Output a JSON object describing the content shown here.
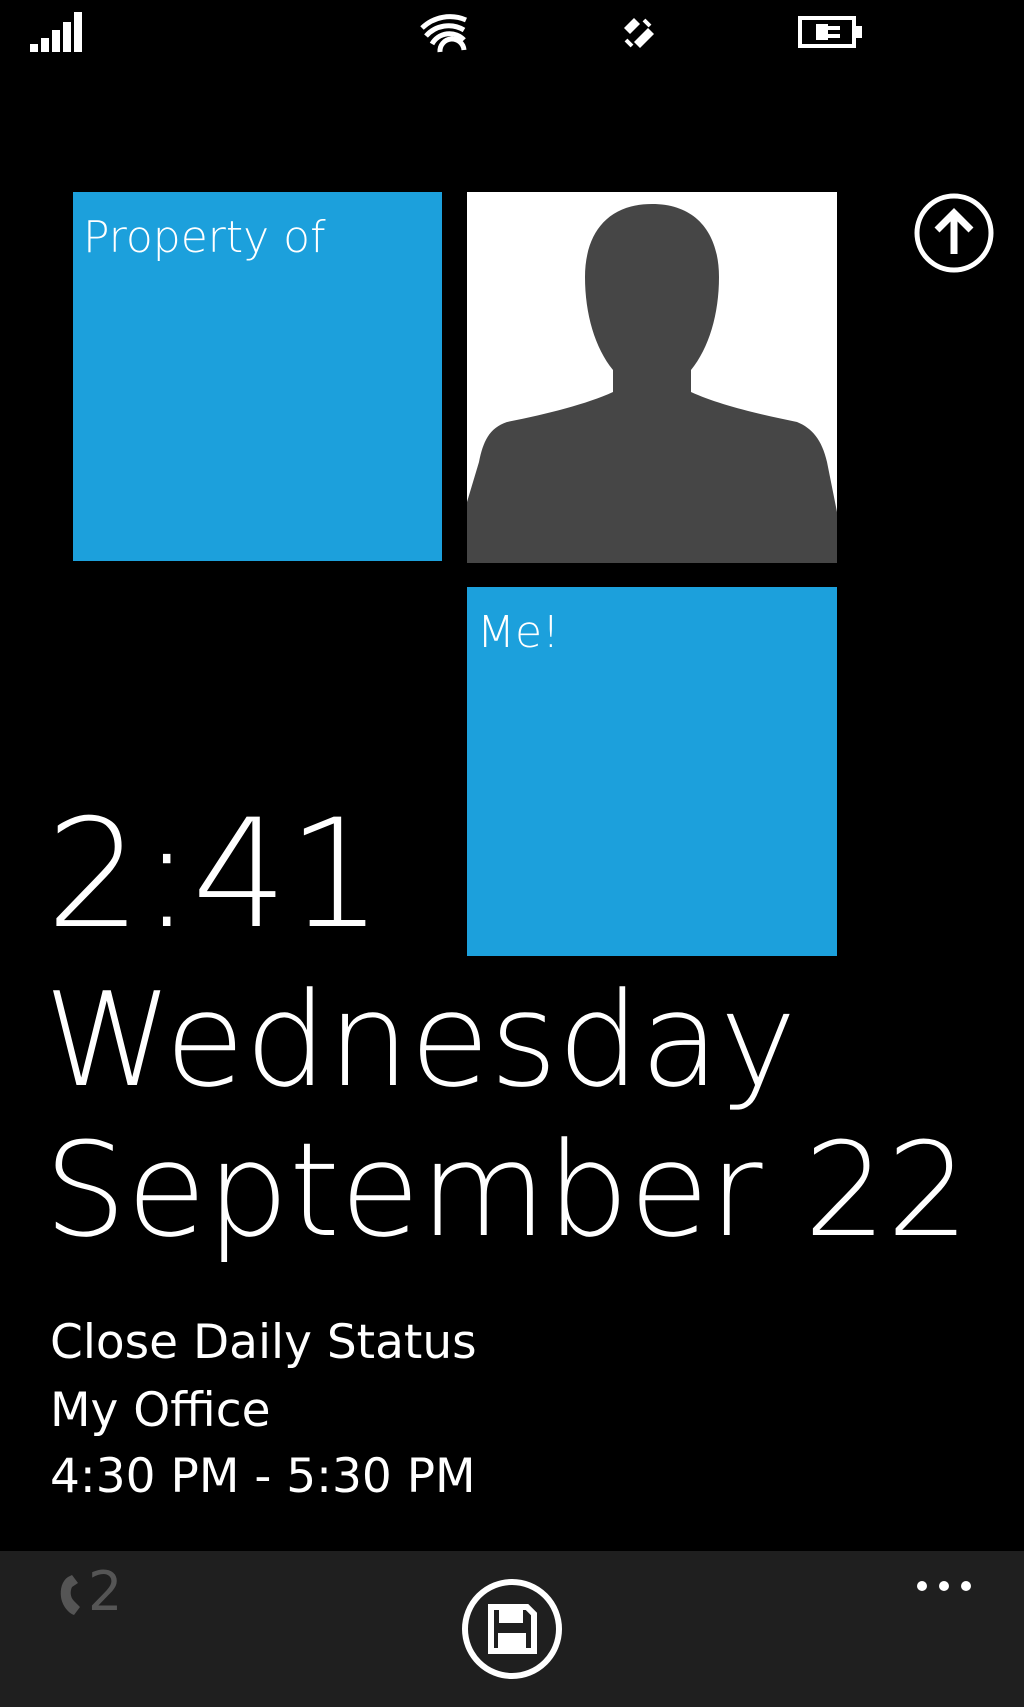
{
  "status_bar": {
    "signal_icon": "signal-strength-icon",
    "wifi_icon": "wifi-icon",
    "vibrate_icon": "vibrate-icon",
    "battery_icon": "battery-charging-icon"
  },
  "tiles": {
    "owner_label": "Property of",
    "me_label": "Me!",
    "color": "#1ca0dc",
    "photo_icon": "person-silhouette-icon"
  },
  "lock_screen": {
    "time": "2:41",
    "weekday": "Wednesday",
    "date": "September 22",
    "appointment": {
      "title": "Close Daily Status",
      "location": "My Office",
      "time_range": "4:30 PM - 5:30 PM"
    }
  },
  "app_bar": {
    "missed_calls_count": "2",
    "phone_icon": "phone-icon",
    "save_icon": "save-icon",
    "more_icon": "ellipsis-icon",
    "up_icon": "arrow-up-icon"
  }
}
